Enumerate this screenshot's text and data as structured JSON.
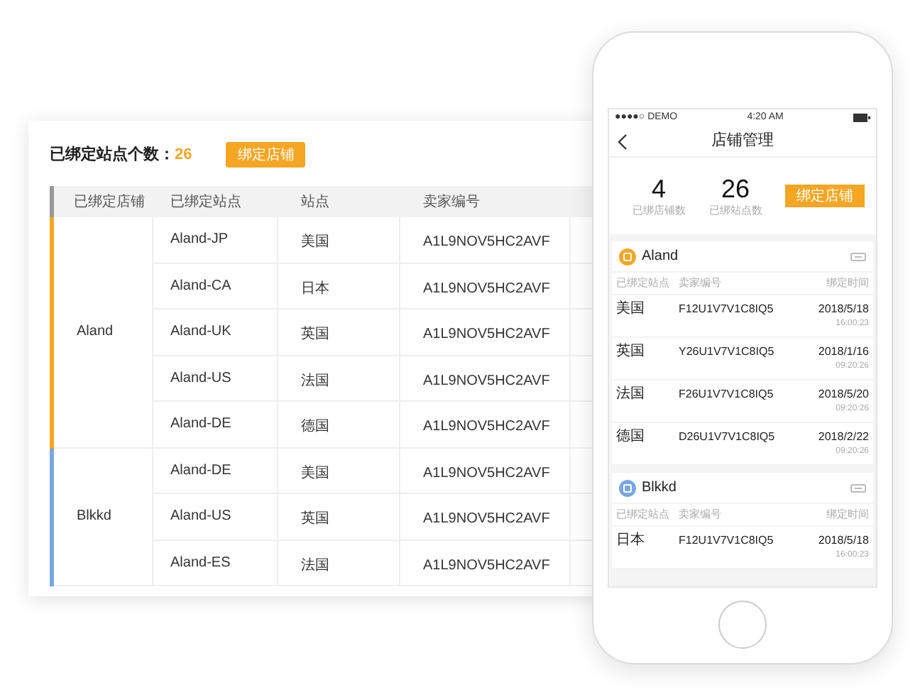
{
  "header": {
    "title": "已绑定站点个数：",
    "count": "26",
    "button": "绑定店铺"
  },
  "table": {
    "columns": [
      "已绑定店铺",
      "已绑定站点",
      "站点",
      "卖家编号"
    ],
    "groups": [
      {
        "store": "Aland",
        "color": "#f5a623",
        "rows": [
          {
            "site": "Aland-JP",
            "country": "美国",
            "seller": "A1L9NOV5HC2AVF"
          },
          {
            "site": "Aland-CA",
            "country": "日本",
            "seller": "A1L9NOV5HC2AVF"
          },
          {
            "site": "Aland-UK",
            "country": "英国",
            "seller": "A1L9NOV5HC2AVF"
          },
          {
            "site": "Aland-US",
            "country": "法国",
            "seller": "A1L9NOV5HC2AVF"
          },
          {
            "site": "Aland-DE",
            "country": "德国",
            "seller": "A1L9NOV5HC2AVF"
          }
        ]
      },
      {
        "store": "Blkkd",
        "color": "#7aa7e0",
        "rows": [
          {
            "site": "Aland-DE",
            "country": "美国",
            "seller": "A1L9NOV5HC2AVF"
          },
          {
            "site": "Aland-US",
            "country": "英国",
            "seller": "A1L9NOV5HC2AVF"
          },
          {
            "site": "Aland-ES",
            "country": "法国",
            "seller": "A1L9NOV5HC2AVF"
          }
        ]
      }
    ]
  },
  "phone": {
    "status": {
      "carrier": "●●●●○ DEMO",
      "time": "4:20 AM"
    },
    "title": "店铺管理",
    "stats": [
      {
        "value": "4",
        "label": "已绑店铺数"
      },
      {
        "value": "26",
        "label": "已绑站点数"
      }
    ],
    "button": "绑定店铺",
    "stores": [
      {
        "name": "Aland",
        "color": "#f5a623",
        "columns": [
          "已绑定站点",
          "卖家编号",
          "绑定时间"
        ],
        "rows": [
          {
            "country": "美国",
            "seller": "F12U1V7V1C8IQ5",
            "date": "2018/5/18",
            "time": "16:00:23"
          },
          {
            "country": "英国",
            "seller": "Y26U1V7V1C8IQ5",
            "date": "2018/1/16",
            "time": "09:20:26"
          },
          {
            "country": "法国",
            "seller": "F26U1V7V1C8IQ5",
            "date": "2018/5/20",
            "time": "09:20:26"
          },
          {
            "country": "德国",
            "seller": "D26U1V7V1C8IQ5",
            "date": "2018/2/22",
            "time": "09:20:26"
          }
        ]
      },
      {
        "name": "Blkkd",
        "color": "#7aa7e0",
        "columns": [
          "已绑定站点",
          "卖家编号",
          "绑定时间"
        ],
        "rows": [
          {
            "country": "日本",
            "seller": "F12U1V7V1C8IQ5",
            "date": "2018/5/18",
            "time": "16:00:23"
          }
        ]
      }
    ]
  }
}
